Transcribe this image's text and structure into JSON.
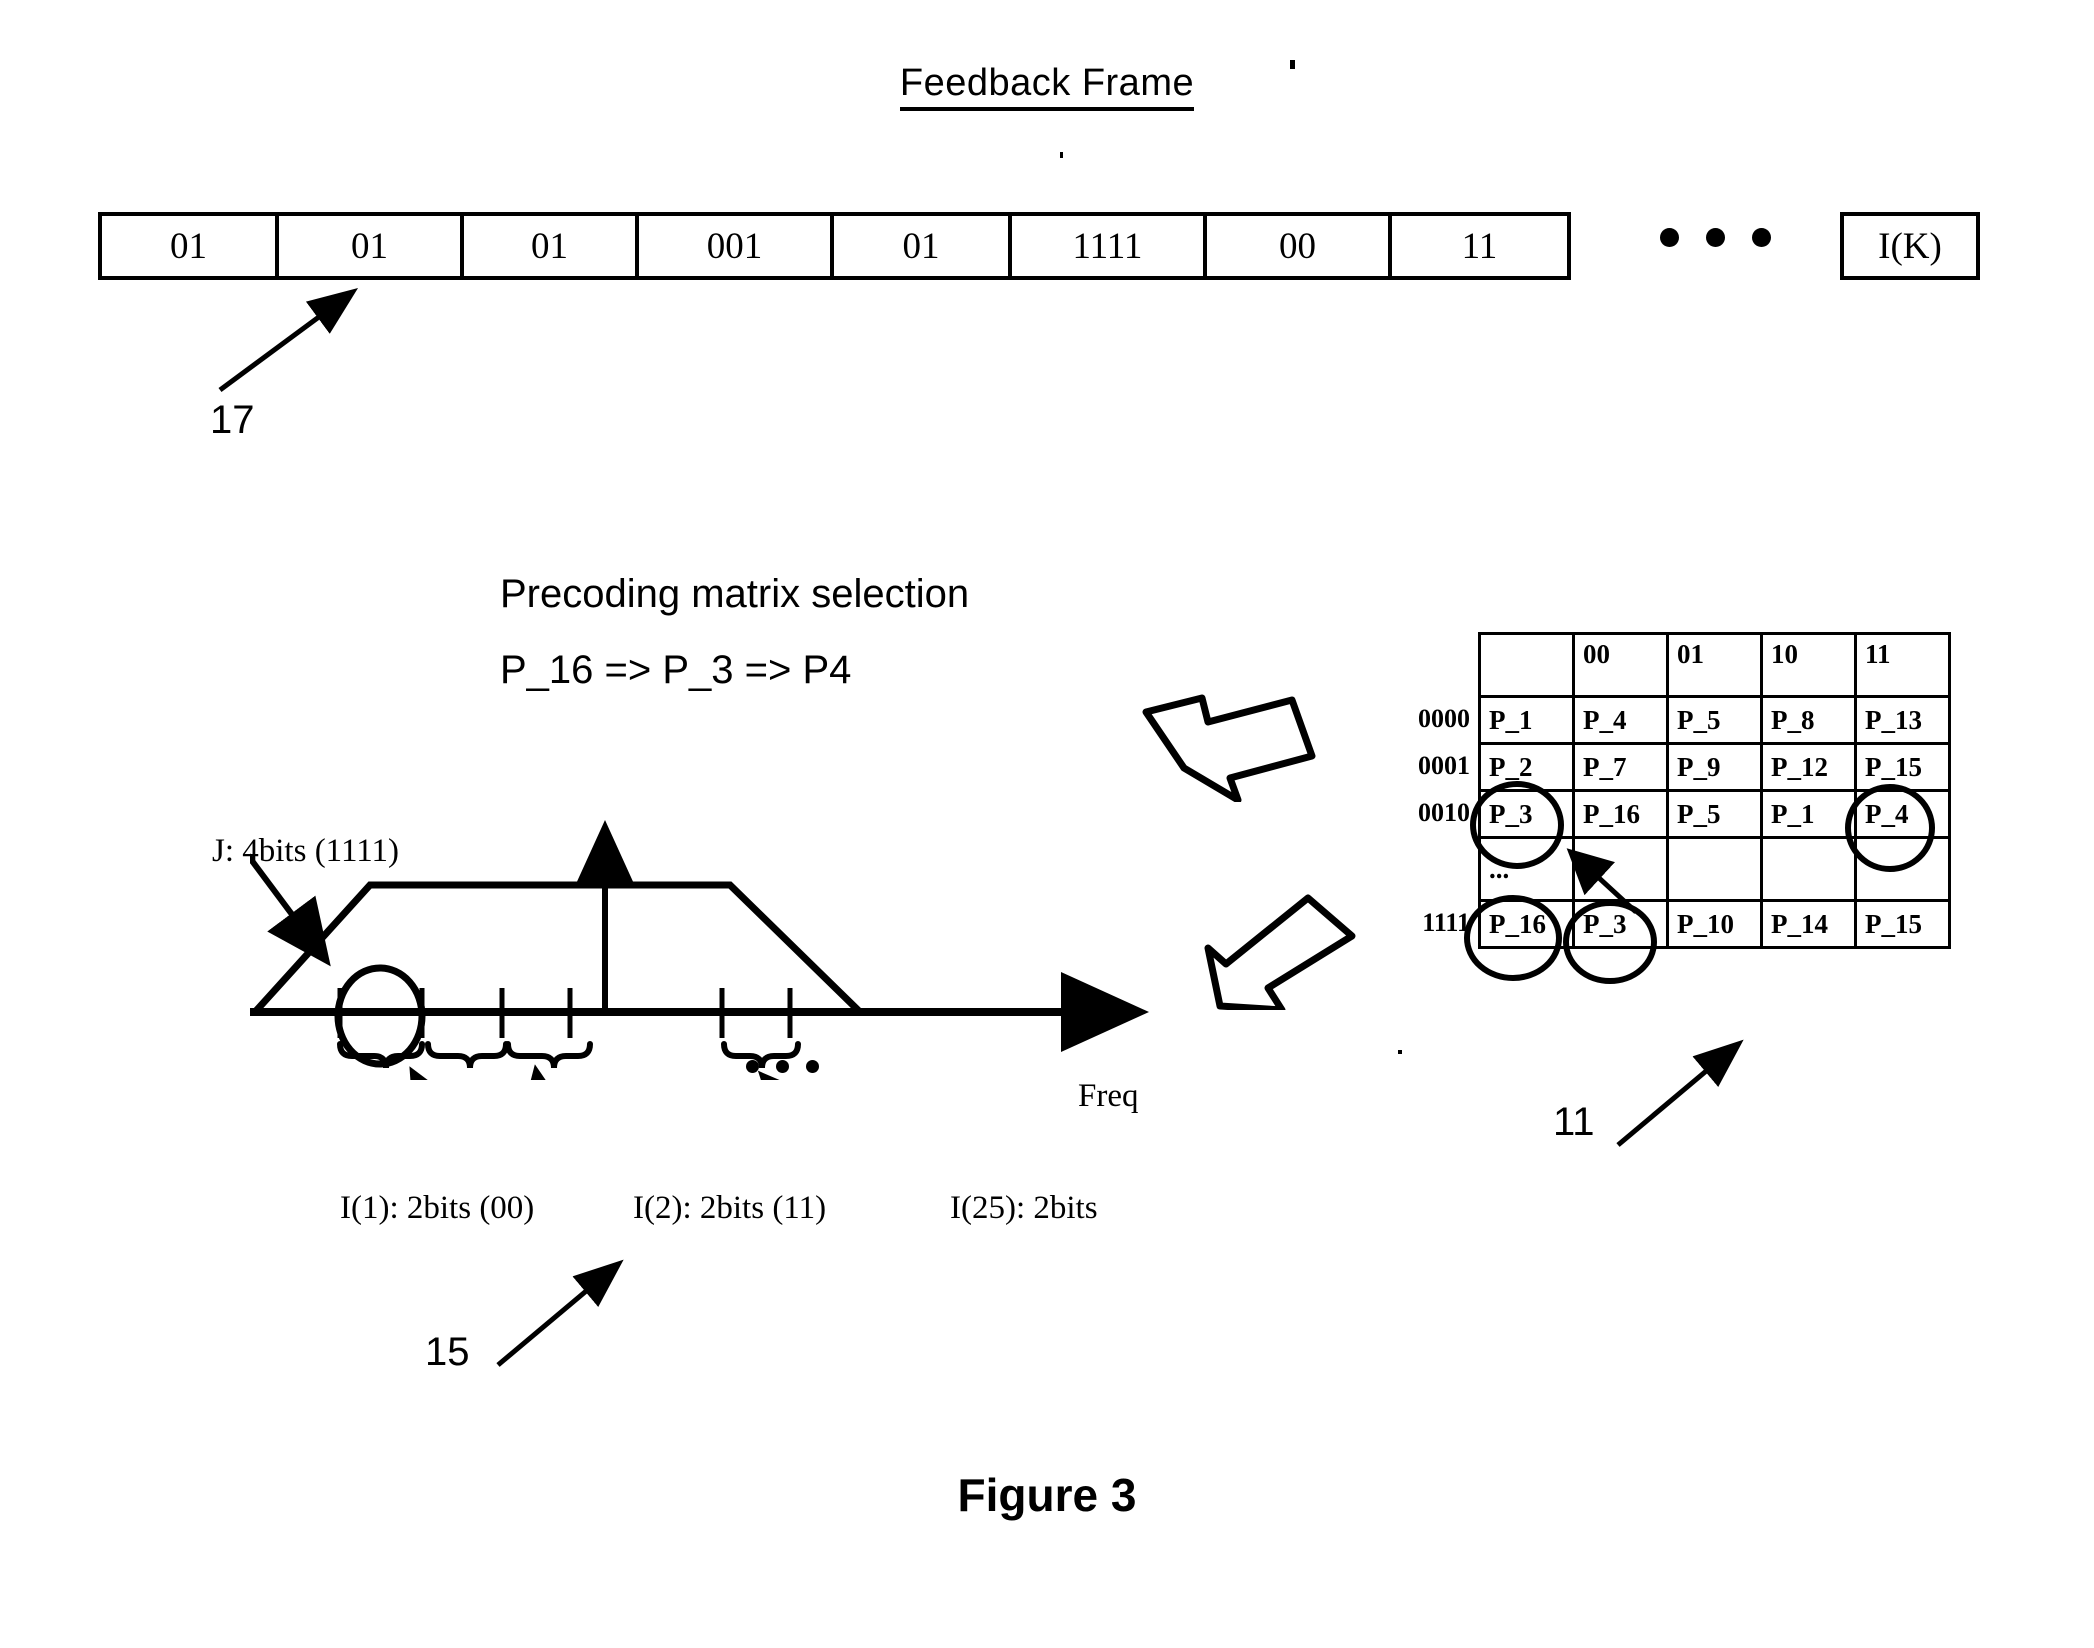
{
  "figure": {
    "caption": "Figure 3",
    "title": "Feedback Frame"
  },
  "feedback_frame": {
    "title": "Feedback Frame",
    "cells": [
      "01",
      "01",
      "01",
      "001",
      "01",
      "1111",
      "00",
      "11"
    ],
    "ellipsis": "• • •",
    "last_cell": "I(K)",
    "ref_number": "17"
  },
  "precoding": {
    "heading": "Precoding matrix selection",
    "sequence": "P_16 => P_3 => P4"
  },
  "spectrum": {
    "j_label": "J: 4bits (1111)",
    "axis_label": "Freq",
    "ellipsis": "...",
    "sub_labels": [
      "I(1): 2bits (00)",
      "I(2): 2bits (11)",
      "I(25): 2bits"
    ],
    "ref_number": "15"
  },
  "matrix_table": {
    "ref_number": "11",
    "column_headers": [
      "",
      "00",
      "01",
      "10",
      "11"
    ],
    "row_labels": [
      "0000",
      "0001",
      "0010",
      "",
      "1111"
    ],
    "rows": [
      [
        "P_1",
        "P_4",
        "P_5",
        "P_8",
        "P_13"
      ],
      [
        "P_2",
        "P_7",
        "P_9",
        "P_12",
        "P_15"
      ],
      [
        "P_3",
        "P_16",
        "P_5",
        "P_1",
        "P_4"
      ],
      [
        "...",
        "",
        "",
        "",
        ""
      ],
      [
        "P_16",
        "P_3",
        "P_10",
        "P_14",
        "P_15"
      ]
    ],
    "circled_cells": [
      "2,0",
      "2,4",
      "4,0",
      "4,1"
    ]
  },
  "colors": {
    "ink": "#000000",
    "background": "#ffffff"
  }
}
